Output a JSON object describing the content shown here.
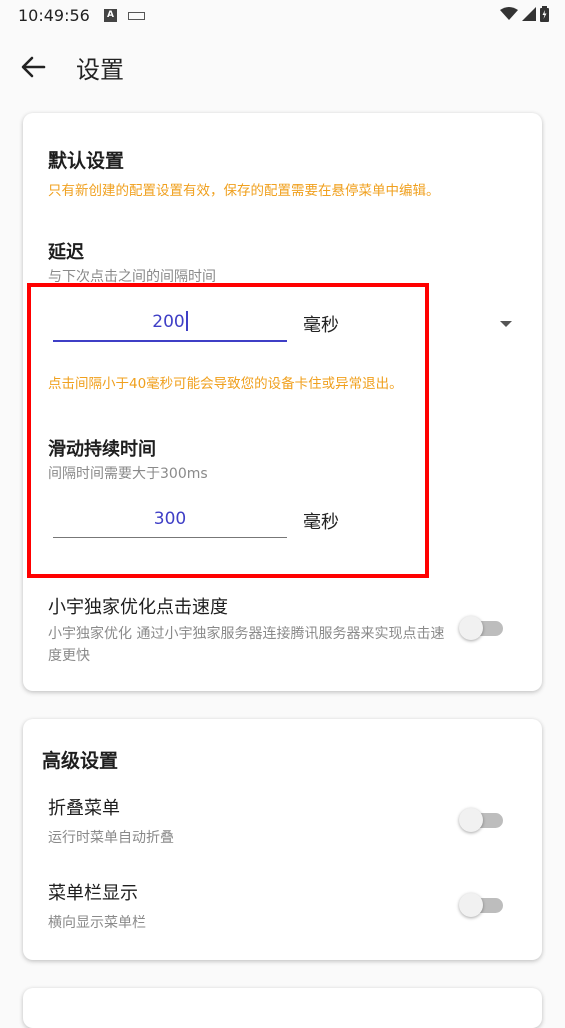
{
  "status_bar": {
    "time": "10:49:56",
    "a_label": "A"
  },
  "header": {
    "title": "设置"
  },
  "default_settings": {
    "title": "默认设置",
    "notice": "只有新创建的配置设置有效，保存的配置需要在悬停菜单中编辑。",
    "delay": {
      "title": "延迟",
      "description": "与下次点击之间的间隔时间",
      "value": "200",
      "unit": "毫秒",
      "warning": "点击间隔小于40毫秒可能会导致您的设备卡住或异常退出。"
    },
    "swipe_duration": {
      "title": "滑动持续时间",
      "description": "间隔时间需要大于300ms",
      "value": "300",
      "unit": "毫秒"
    },
    "speed_optimization": {
      "title": "小宇独家优化点击速度",
      "description": "小宇独家优化  通过小宇独家服务器连接腾讯服务器来实现点击速度更快",
      "enabled": false
    }
  },
  "advanced_settings": {
    "title": "高级设置",
    "collapse_menu": {
      "title": "折叠菜单",
      "description": "运行时菜单自动折叠",
      "enabled": false
    },
    "menu_bar_display": {
      "title": "菜单栏显示",
      "description": "横向显示菜单栏",
      "enabled": false
    }
  },
  "colors": {
    "accent": "#3f3fc6",
    "warning": "#f0a01e",
    "highlight_box": "#ff0000"
  }
}
